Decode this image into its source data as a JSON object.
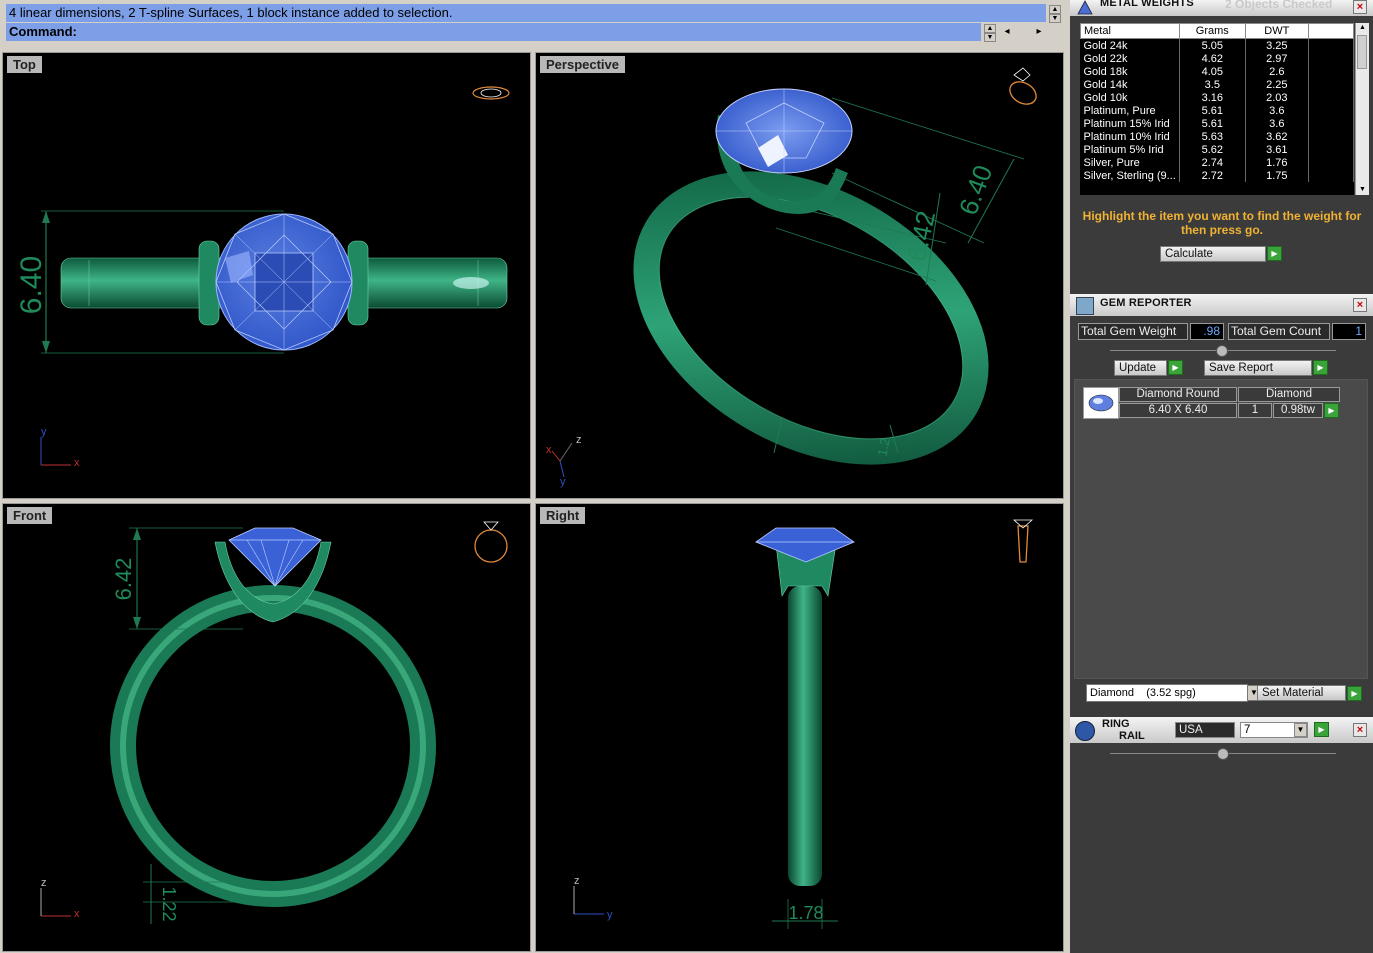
{
  "command": {
    "history": "4 linear dimensions, 2 T-spline Surfaces, 1 block instance added to selection.",
    "prompt": "Command:"
  },
  "viewports": {
    "top": {
      "label": "Top",
      "dim": "6.40",
      "axis_x": "x",
      "axis_y": "y"
    },
    "perspective": {
      "label": "Perspective",
      "dim_a": "6.40",
      "dim_b": "6.42",
      "dim_c": "1.2",
      "axis_x": "x",
      "axis_y": "y",
      "axis_z": "z"
    },
    "front": {
      "label": "Front",
      "dim_a": "6.42",
      "dim_b": "1.22",
      "axis_x": "x",
      "axis_z": "z"
    },
    "right": {
      "label": "Right",
      "dim_a": "1.78",
      "axis_y": "y",
      "axis_z": "z"
    }
  },
  "metal_weights": {
    "title": "METAL WEIGHTS",
    "status": "2 Objects Checked",
    "columns": [
      "Metal",
      "Grams",
      "DWT"
    ],
    "rows": [
      [
        "Gold 24k",
        "5.05",
        "3.25"
      ],
      [
        "Gold 22k",
        "4.62",
        "2.97"
      ],
      [
        "Gold 18k",
        "4.05",
        "2.6"
      ],
      [
        "Gold 14k",
        "3.5",
        "2.25"
      ],
      [
        "Gold 10k",
        "3.16",
        "2.03"
      ],
      [
        "Platinum, Pure",
        "5.61",
        "3.6"
      ],
      [
        "Platinum 15% Irid",
        "5.61",
        "3.6"
      ],
      [
        "Platinum 10% Irid",
        "5.63",
        "3.62"
      ],
      [
        "Platinum 5% Irid",
        "5.62",
        "3.61"
      ],
      [
        "Silver, Pure",
        "2.74",
        "1.76"
      ],
      [
        "Silver, Sterling (9...",
        "2.72",
        "1.75"
      ]
    ],
    "hint": "Highlight the item you want to find the weight for then press go.",
    "calculate_label": "Calculate"
  },
  "gem_reporter": {
    "title": "GEM REPORTER",
    "total_weight_label": "Total Gem Weight",
    "total_weight_value": ".98",
    "total_count_label": "Total Gem Count",
    "total_count_value": "1",
    "update_label": "Update",
    "save_label": "Save Report",
    "gem": {
      "shape": "Diamond Round",
      "type": "Diamond",
      "size": "6.40 X 6.40",
      "qty": "1",
      "tw": "0.98tw"
    },
    "material_select": "Diamond    (3.52 spg)",
    "set_material_label": "Set Material"
  },
  "ring_rail": {
    "title_line1": "RING",
    "title_line2": "RAIL",
    "region": "USA",
    "size": "7"
  }
}
